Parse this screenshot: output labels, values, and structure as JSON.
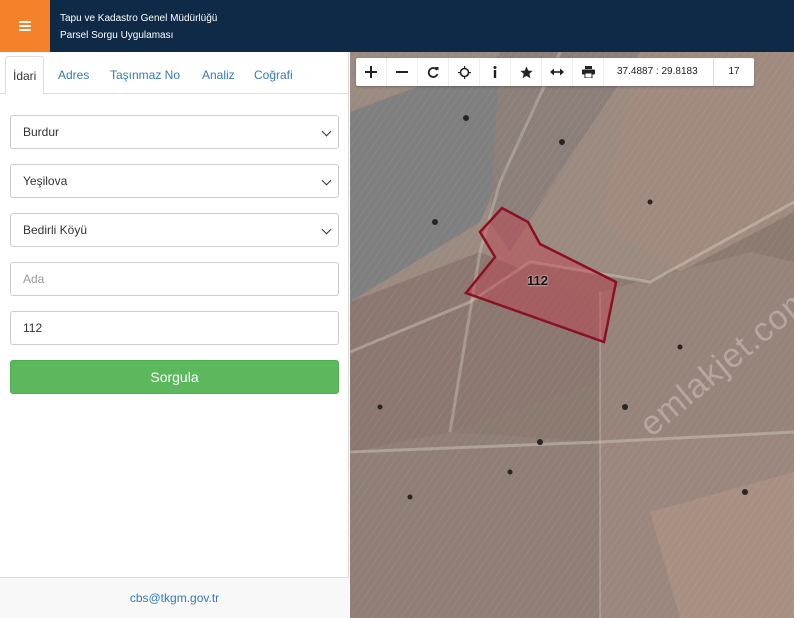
{
  "header": {
    "line1": "Tapu ve Kadastro Genel Müdürlüğü",
    "line2": "Parsel Sorgu Uygulaması",
    "menu_icon": "hamburger-icon"
  },
  "tabs": [
    "İdari",
    "Adres",
    "Taşınmaz No",
    "Analiz",
    "Coğrafi"
  ],
  "form": {
    "il": "Burdur",
    "ilce": "Yeşilova",
    "mahalle": "Bedirli Köyü",
    "ada_placeholder": "Ada",
    "ada_value": "",
    "parsel": "112",
    "submit": "Sorgula"
  },
  "footer": {
    "email": "cbs@tkgm.gov.tr"
  },
  "map": {
    "toolbar": [
      "zoom-in-icon",
      "zoom-out-icon",
      "refresh-icon",
      "locate-icon",
      "info-icon",
      "star-icon",
      "measure-icon",
      "print-icon"
    ],
    "coordinates": "37.4887 : 29.8183",
    "zoom_level": "17",
    "parcel_label": "112",
    "watermark": "emlakjet.com",
    "parcel_stroke": "#8b1024",
    "parcel_fill": "#c83a4a"
  },
  "colors": {
    "header_bg": "#0f2a47",
    "menu_bg": "#f5822a",
    "button_green": "#5cb85c",
    "link_blue": "#337ab7"
  }
}
